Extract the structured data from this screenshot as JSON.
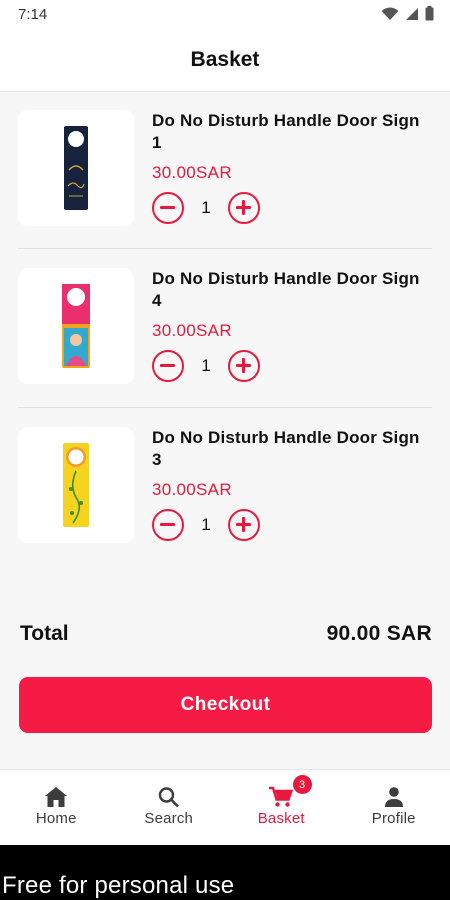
{
  "status_bar": {
    "time": "7:14"
  },
  "header": {
    "title": "Basket"
  },
  "items": [
    {
      "name": "Do No Disturb Handle Door Sign 1",
      "price": "30.00SAR",
      "quantity": "1"
    },
    {
      "name": "Do No Disturb Handle Door Sign 4",
      "price": "30.00SAR",
      "quantity": "1"
    },
    {
      "name": "Do No Disturb Handle Door Sign 3",
      "price": "30.00SAR",
      "quantity": "1"
    }
  ],
  "summary": {
    "total_label": "Total",
    "total_value": "90.00 SAR"
  },
  "checkout": {
    "label": "Checkout"
  },
  "bottom_nav": {
    "items": [
      {
        "label": "Home",
        "icon": "home-icon"
      },
      {
        "label": "Search",
        "icon": "search-icon"
      },
      {
        "label": "Basket",
        "icon": "cart-icon",
        "active": true,
        "badge": "3"
      },
      {
        "label": "Profile",
        "icon": "person-icon"
      }
    ]
  },
  "watermark": "Free for personal use",
  "colors": {
    "accent": "#e8193c",
    "button": "#f51b45",
    "background": "#f7f7f7"
  }
}
